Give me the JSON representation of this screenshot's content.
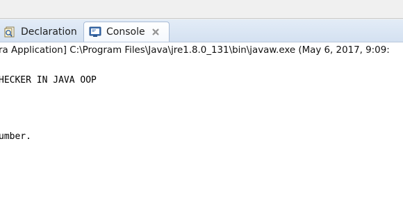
{
  "tabs": [
    {
      "label": "Declaration",
      "icon": "declaration-icon",
      "active": false
    },
    {
      "label": "Console",
      "icon": "console-icon",
      "active": true,
      "closable": true
    }
  ],
  "console": {
    "launch_info": "ra Application] C:\\Program Files\\Java\\jre1.8.0_131\\bin\\javaw.exe (May 6, 2017, 9:09:",
    "lines": [
      "HECKER IN JAVA OOP",
      "umber."
    ]
  },
  "colors": {
    "tabbar_top": "#e3ecf7",
    "tabbar_bottom": "#d4e1f1",
    "active_tab": "#ffffff",
    "console_text": "#000000"
  }
}
